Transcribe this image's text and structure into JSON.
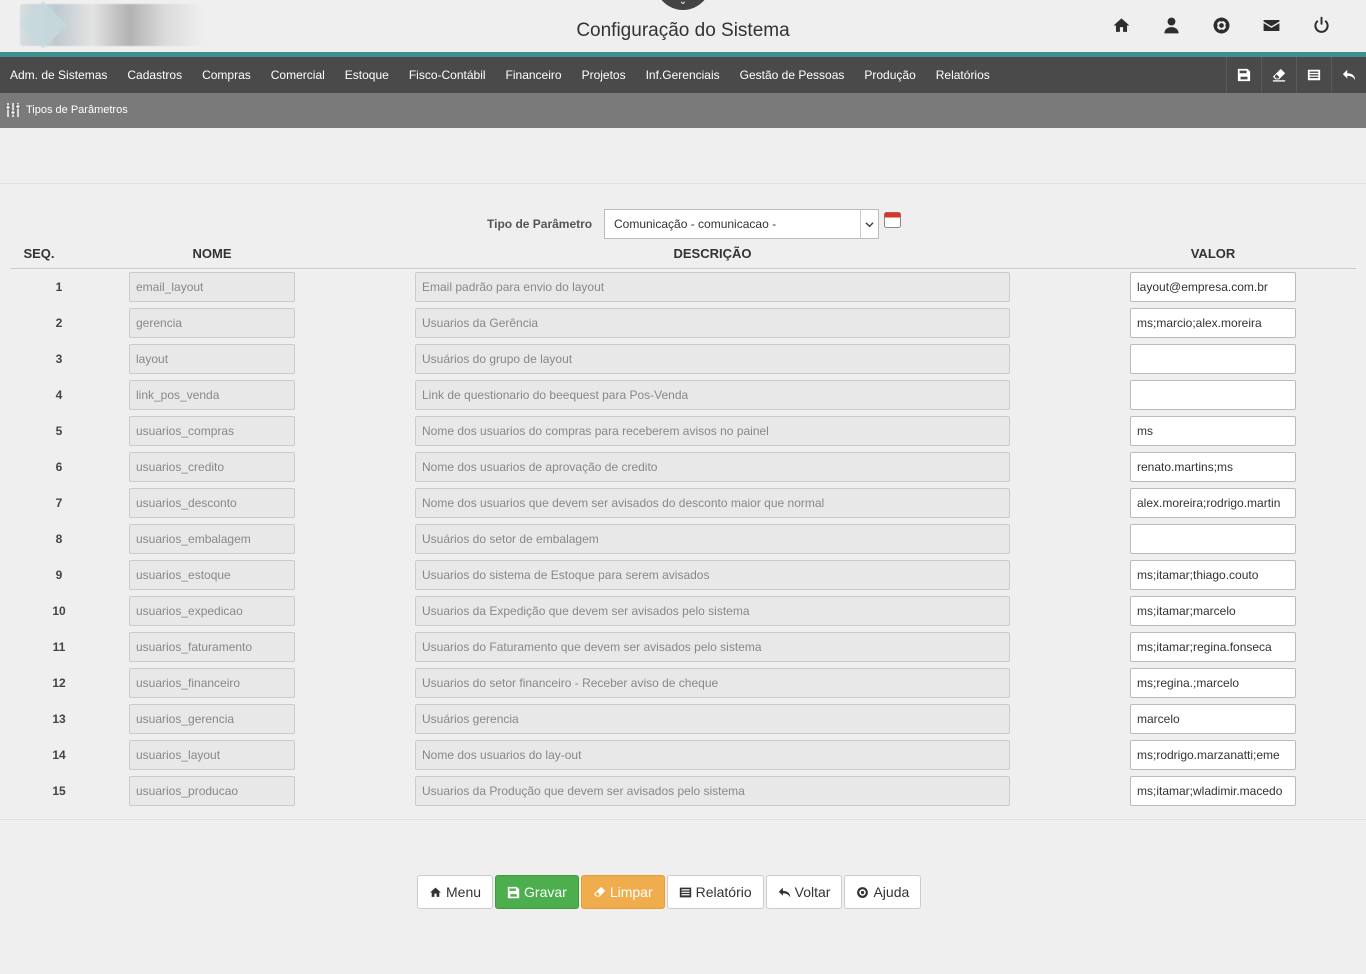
{
  "header": {
    "title": "Configuração do Sistema",
    "icons": [
      "home-icon",
      "user-icon",
      "lifebuoy-icon",
      "envelope-icon",
      "power-icon"
    ]
  },
  "menu": {
    "items": [
      "Adm. de Sistemas",
      "Cadastros",
      "Compras",
      "Comercial",
      "Estoque",
      "Fisco-Contábil",
      "Financeiro",
      "Projetos",
      "Inf.Gerenciais",
      "Gestão de Pessoas",
      "Produção",
      "Relatórios"
    ],
    "tools": [
      "save-icon",
      "eraser-icon",
      "report-icon",
      "back-icon"
    ]
  },
  "breadcrumb": {
    "label": "Tipos de Parâmetros"
  },
  "filter": {
    "label": "Tipo de Parâmetro",
    "selected": "Comunicação - comunicacao -"
  },
  "table": {
    "headers": {
      "seq": "SEQ.",
      "nome": "NOME",
      "descricao": "DESCRIÇÃO",
      "valor": "VALOR"
    },
    "rows": [
      {
        "seq": "1",
        "nome": "email_layout",
        "descricao": "Email padrão para envio do layout",
        "valor": "layout@empresa.com.br"
      },
      {
        "seq": "2",
        "nome": "gerencia",
        "descricao": "Usuarios da Gerência",
        "valor": "ms;marcio;alex.moreira"
      },
      {
        "seq": "3",
        "nome": "layout",
        "descricao": "Usuários do grupo de layout",
        "valor": ""
      },
      {
        "seq": "4",
        "nome": "link_pos_venda",
        "descricao": "Link de questionario do beequest para Pos-Venda",
        "valor": ""
      },
      {
        "seq": "5",
        "nome": "usuarios_compras",
        "descricao": "Nome dos usuarios do compras para receberem avisos no painel",
        "valor": "ms"
      },
      {
        "seq": "6",
        "nome": "usuarios_credito",
        "descricao": "Nome dos usuarios de aprovação de credito",
        "valor": "renato.martins;ms"
      },
      {
        "seq": "7",
        "nome": "usuarios_desconto",
        "descricao": "Nome dos usuarios que devem ser avisados do desconto maior que normal",
        "valor": "alex.moreira;rodrigo.martin"
      },
      {
        "seq": "8",
        "nome": "usuarios_embalagem",
        "descricao": "Usuários do setor de embalagem",
        "valor": ""
      },
      {
        "seq": "9",
        "nome": "usuarios_estoque",
        "descricao": "Usuarios do sistema de Estoque para serem avisados",
        "valor": "ms;itamar;thiago.couto"
      },
      {
        "seq": "10",
        "nome": "usuarios_expedicao",
        "descricao": "Usuarios da Expedição que devem ser avisados pelo sistema",
        "valor": "ms;itamar;marcelo"
      },
      {
        "seq": "11",
        "nome": "usuarios_faturamento",
        "descricao": "Usuarios do Faturamento que devem ser avisados pelo sistema",
        "valor": "ms;itamar;regina.fonseca"
      },
      {
        "seq": "12",
        "nome": "usuarios_financeiro",
        "descricao": "Usuarios do setor financeiro - Receber aviso de cheque",
        "valor": "ms;regina.;marcelo"
      },
      {
        "seq": "13",
        "nome": "usuarios_gerencia",
        "descricao": "Usuários gerencia",
        "valor": "marcelo"
      },
      {
        "seq": "14",
        "nome": "usuarios_layout",
        "descricao": "Nome dos usuarios do lay-out",
        "valor": "ms;rodrigo.marzanatti;eme"
      },
      {
        "seq": "15",
        "nome": "usuarios_producao",
        "descricao": "Usuarios da Produção que devem ser avisados pelo sistema",
        "valor": "ms;itamar;wladimir.macedo"
      }
    ]
  },
  "buttons": {
    "menu": "Menu",
    "gravar": "Gravar",
    "limpar": "Limpar",
    "relatorio": "Relatório",
    "voltar": "Voltar",
    "ajuda": "Ajuda"
  },
  "colors": {
    "accent_teal": "#3f8f8f",
    "menubar": "#4a4a4a",
    "breadcrumb_bar": "#7a7a7a",
    "gravar": "#4cae4c",
    "limpar": "#f0ad4e"
  }
}
